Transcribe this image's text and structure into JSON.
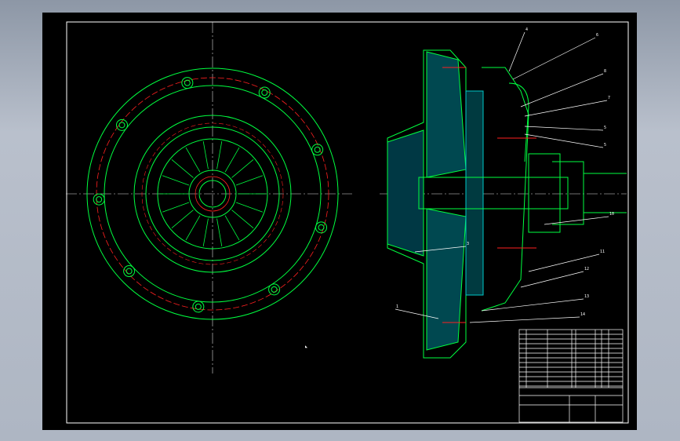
{
  "drawing": {
    "balloons": [
      "4",
      "6",
      "8",
      "7",
      "5",
      "5",
      "10",
      "11",
      "12",
      "13",
      "14",
      "1",
      "3"
    ],
    "colors": {
      "outline": "#00ff40",
      "center": "#ff2020",
      "hatch": "#00c8c8",
      "dim": "#ffffff",
      "frame": "#ffffff"
    }
  }
}
